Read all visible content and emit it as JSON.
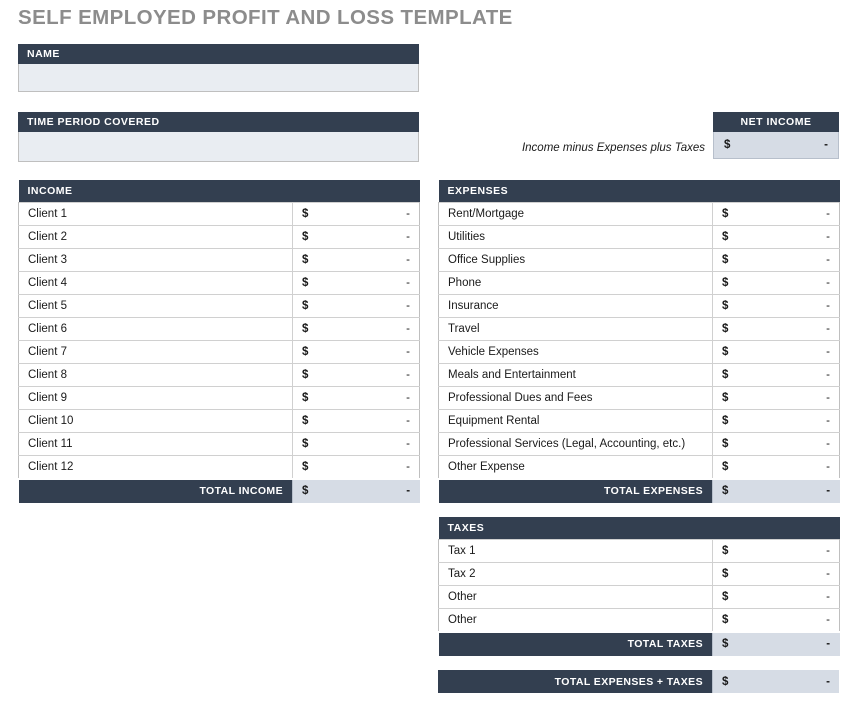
{
  "page": {
    "title": "SELF EMPLOYED PROFIT AND LOSS TEMPLATE"
  },
  "name_block": {
    "header": "NAME",
    "value": ""
  },
  "time_period_block": {
    "header": "TIME PERIOD COVERED",
    "value": ""
  },
  "net_income": {
    "header": "NET INCOME",
    "formula_note": "Income minus Expenses plus Taxes",
    "currency": "$",
    "value": "-"
  },
  "currency_symbol": "$",
  "empty_value": "-",
  "income": {
    "header": "INCOME",
    "rows": [
      {
        "label": "Client 1",
        "currency": "$",
        "value": "-"
      },
      {
        "label": "Client 2",
        "currency": "$",
        "value": "-"
      },
      {
        "label": "Client 3",
        "currency": "$",
        "value": "-"
      },
      {
        "label": "Client 4",
        "currency": "$",
        "value": "-"
      },
      {
        "label": "Client 5",
        "currency": "$",
        "value": "-"
      },
      {
        "label": "Client 6",
        "currency": "$",
        "value": "-"
      },
      {
        "label": "Client 7",
        "currency": "$",
        "value": "-"
      },
      {
        "label": "Client 8",
        "currency": "$",
        "value": "-"
      },
      {
        "label": "Client 9",
        "currency": "$",
        "value": "-"
      },
      {
        "label": "Client 10",
        "currency": "$",
        "value": "-"
      },
      {
        "label": "Client 11",
        "currency": "$",
        "value": "-"
      },
      {
        "label": "Client 12",
        "currency": "$",
        "value": "-"
      }
    ],
    "total": {
      "label": "TOTAL INCOME",
      "currency": "$",
      "value": "-"
    }
  },
  "expenses": {
    "header": "EXPENSES",
    "rows": [
      {
        "label": "Rent/Mortgage",
        "currency": "$",
        "value": "-"
      },
      {
        "label": "Utilities",
        "currency": "$",
        "value": "-"
      },
      {
        "label": "Office Supplies",
        "currency": "$",
        "value": "-"
      },
      {
        "label": "Phone",
        "currency": "$",
        "value": "-"
      },
      {
        "label": "Insurance",
        "currency": "$",
        "value": "-"
      },
      {
        "label": "Travel",
        "currency": "$",
        "value": "-"
      },
      {
        "label": "Vehicle Expenses",
        "currency": "$",
        "value": "-"
      },
      {
        "label": "Meals and Entertainment",
        "currency": "$",
        "value": "-"
      },
      {
        "label": "Professional Dues and Fees",
        "currency": "$",
        "value": "-"
      },
      {
        "label": "Equipment Rental",
        "currency": "$",
        "value": "-"
      },
      {
        "label": "Professional Services (Legal, Accounting, etc.)",
        "currency": "$",
        "value": "-"
      },
      {
        "label": "Other Expense",
        "currency": "$",
        "value": "-"
      }
    ],
    "total": {
      "label": "TOTAL EXPENSES",
      "currency": "$",
      "value": "-"
    }
  },
  "taxes": {
    "header": "TAXES",
    "rows": [
      {
        "label": "Tax 1",
        "currency": "$",
        "value": "-"
      },
      {
        "label": "Tax 2",
        "currency": "$",
        "value": "-"
      },
      {
        "label": "Other",
        "currency": "$",
        "value": "-"
      },
      {
        "label": "Other",
        "currency": "$",
        "value": "-"
      }
    ],
    "total": {
      "label": "TOTAL TAXES",
      "currency": "$",
      "value": "-"
    }
  },
  "grand_total": {
    "label": "TOTAL EXPENSES + TAXES",
    "currency": "$",
    "value": "-"
  },
  "colors": {
    "header_navy": "#333f50",
    "total_fill": "#d6dce5",
    "input_fill": "#e9edf2",
    "title_gray": "#8c8c8c"
  }
}
